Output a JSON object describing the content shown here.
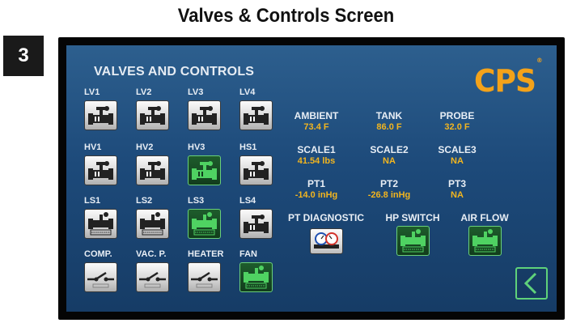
{
  "caption": "Valves & Controls Screen",
  "step_number": "3",
  "screen": {
    "title": "VALVES AND CONTROLS",
    "logo_text": "CPS",
    "logo_mark": "®",
    "accent_color": "#f3a21a",
    "value_color": "#f2b51f",
    "active_color": "#5fd27a"
  },
  "valves": [
    {
      "label": "LV1",
      "type": "valve",
      "state": "off"
    },
    {
      "label": "LV2",
      "type": "valve",
      "state": "off"
    },
    {
      "label": "LV3",
      "type": "valve",
      "state": "off"
    },
    {
      "label": "LV4",
      "type": "valve",
      "state": "off"
    },
    {
      "label": "HV1",
      "type": "valve",
      "state": "off"
    },
    {
      "label": "HV2",
      "type": "valve",
      "state": "off"
    },
    {
      "label": "HV3",
      "type": "valve",
      "state": "on"
    },
    {
      "label": "HS1",
      "type": "valve",
      "state": "off"
    },
    {
      "label": "LS1",
      "type": "switch",
      "state": "off"
    },
    {
      "label": "LS2",
      "type": "switch",
      "state": "off"
    },
    {
      "label": "LS3",
      "type": "switch",
      "state": "on"
    },
    {
      "label": "LS4",
      "type": "valve",
      "state": "off"
    },
    {
      "label": "COMP.",
      "type": "relay",
      "state": "off"
    },
    {
      "label": "VAC. P.",
      "type": "relay",
      "state": "off"
    },
    {
      "label": "HEATER",
      "type": "relay",
      "state": "off"
    },
    {
      "label": "FAN",
      "type": "switch",
      "state": "on"
    }
  ],
  "readings": [
    {
      "label": "AMBIENT",
      "value": "73.4 F"
    },
    {
      "label": "TANK",
      "value": "86.0 F"
    },
    {
      "label": "PROBE",
      "value": "32.0 F"
    },
    {
      "label": "SCALE1",
      "value": "41.54 lbs"
    },
    {
      "label": "SCALE2",
      "value": "NA"
    },
    {
      "label": "SCALE3",
      "value": "NA"
    },
    {
      "label": "PT1",
      "value": "-14.0 inHg"
    },
    {
      "label": "PT2",
      "value": "-26.8 inHg"
    },
    {
      "label": "PT3",
      "value": "NA"
    }
  ],
  "extras": [
    {
      "label": "PT DIAGNOSTIC",
      "icon": "gauges-icon",
      "state": "off"
    },
    {
      "label": "HP SWITCH",
      "icon": "switch-icon",
      "state": "on"
    },
    {
      "label": "AIR FLOW",
      "icon": "switch-icon",
      "state": "on"
    }
  ],
  "back_icon": "chevron-left-icon"
}
